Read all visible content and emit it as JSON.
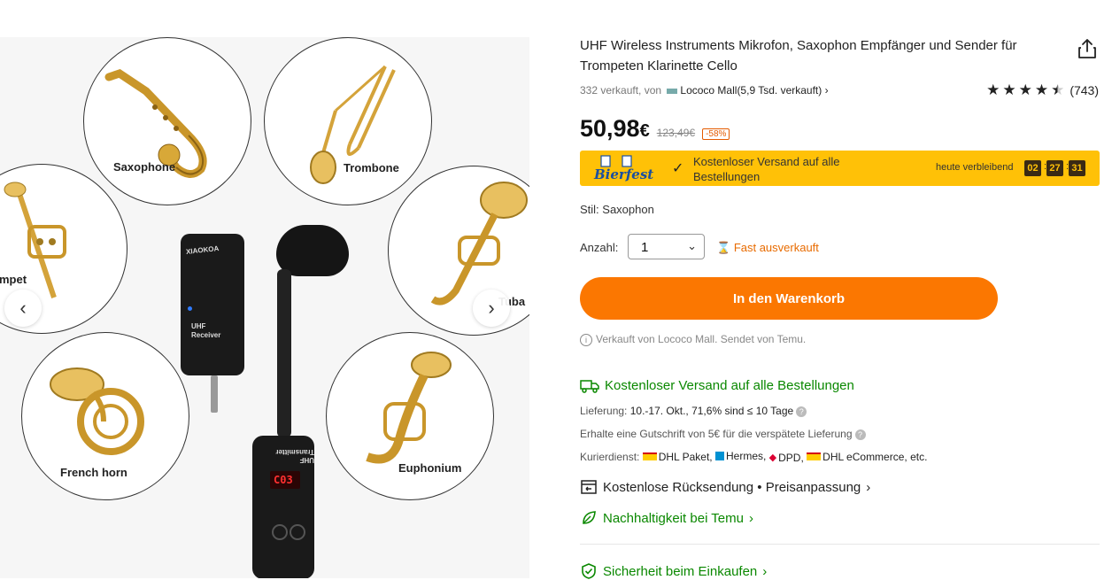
{
  "gallery": {
    "labels": {
      "saxophone": "Saxophone",
      "trombone": "Trombone",
      "trumpet": "mpet",
      "tuba": "Tuba",
      "french_horn": "French horn",
      "euphonium": "Euphonium"
    },
    "receiver_brand": "XIAOKOA",
    "receiver_label": "UHF Receiver",
    "transmitter_label": "UHF Transmitter",
    "display_value": "C03",
    "prev_icon": "chevron-left-icon",
    "next_icon": "chevron-right-icon"
  },
  "product": {
    "title": "UHF Wireless Instruments Mikrofon, Saxophon Empfänger und Sender für Trompeten Klarinette Cello",
    "sold": "332 verkauft, von",
    "mall": "Lococo Mall(5,9 Tsd. verkauft)",
    "rating": 4.5,
    "reviews": "(743)",
    "price": "50,98",
    "currency": "€",
    "old_price": "123,49€",
    "discount": "-58%"
  },
  "banner": {
    "logo_text": "Bierfest",
    "text": "Kostenloser Versand auf alle Bestellungen",
    "remaining": "heute verbleibend",
    "hh": "02",
    "mm": "27",
    "ss": "31",
    "color": "#ffc107"
  },
  "options": {
    "style": "Stil: Saxophon",
    "qty_label": "Anzahl:",
    "qty_value": "1",
    "stock": "Fast ausverkauft"
  },
  "cart": {
    "label": "In den Warenkorb",
    "color": "#fb7701"
  },
  "sold_by": "Verkauft von Lococo Mall. Sendet von Temu.",
  "shipping": {
    "title": "Kostenloser Versand auf alle Bestellungen",
    "delivery_label": "Lieferung:",
    "delivery_value": "10.-17. Okt., 71,6% sind ≤ 10 Tage",
    "voucher": "Erhalte eine Gutschrift von 5€ für die verspätete Lieferung",
    "courier_label": "Kurierdienst:",
    "carriers": [
      "DHL Paket,",
      "Hermes,",
      "DPD,",
      "DHL eCommerce, etc."
    ]
  },
  "returns": "Kostenlose Rücksendung • Preisanpassung",
  "sustainability": "Nachhaltigkeit bei Temu",
  "security": "Sicherheit beim Einkaufen",
  "accent_green": "#0a8800"
}
